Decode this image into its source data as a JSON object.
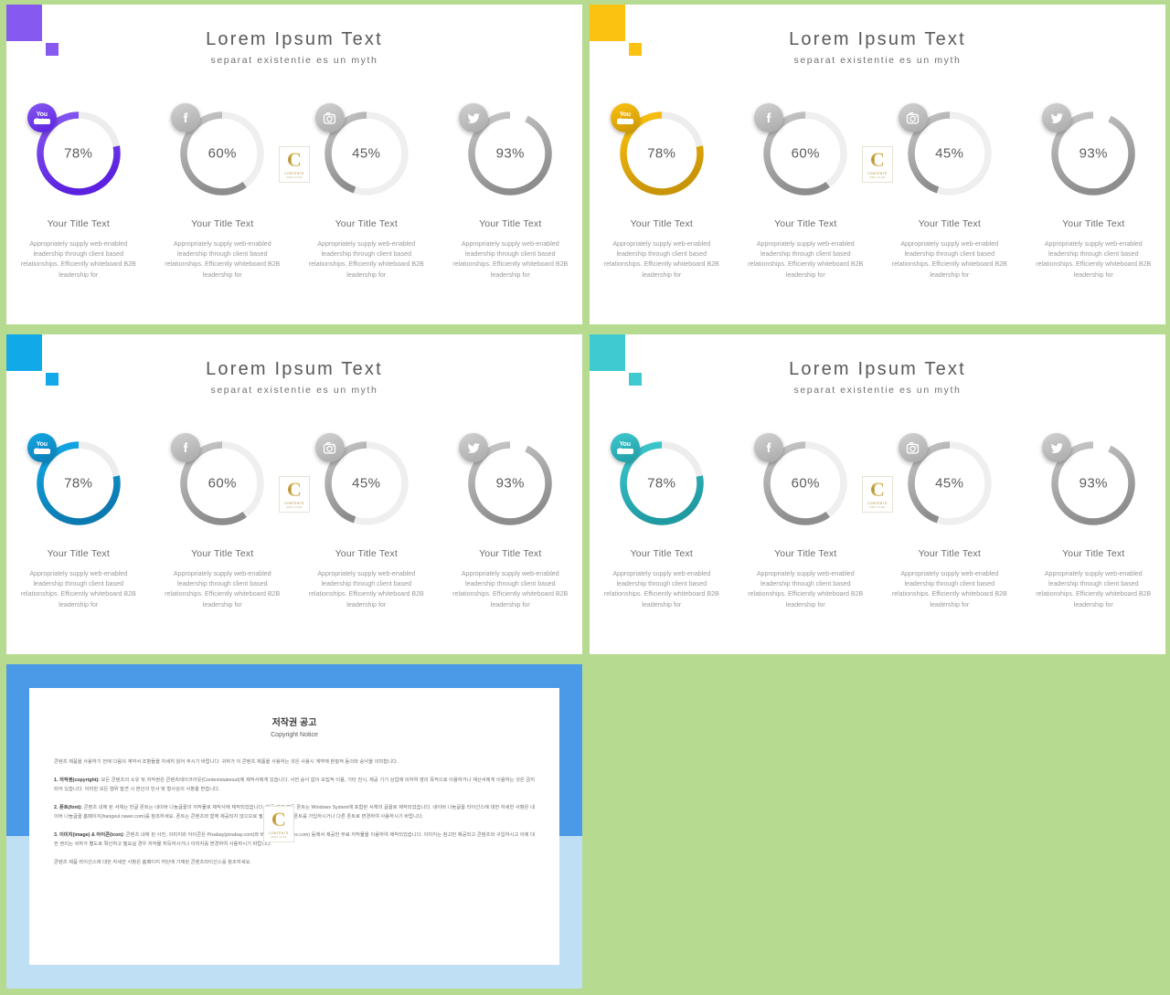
{
  "background_color": "#b6db90",
  "slides": [
    {
      "key": "purple",
      "accent": "#8659f0",
      "accent_dark": "#5b20e0",
      "title": "Lorem Ipsum Text",
      "subtitle": "separat existentie es un myth",
      "items": [
        {
          "icon": "youtube-icon",
          "percent": "78%",
          "value": 78,
          "title": "Your Title Text",
          "body": "Appropriately supply web-enabled leadership through client based relationships. Efficiently whiteboard B2B leadership for",
          "colored": true
        },
        {
          "icon": "facebook-icon",
          "percent": "60%",
          "value": 60,
          "title": "Your Title Text",
          "body": "Appropriately supply web-enabled leadership through client based relationships. Efficiently whiteboard B2B leadership for",
          "colored": false
        },
        {
          "icon": "instagram-icon",
          "percent": "45%",
          "value": 45,
          "title": "Your Title Text",
          "body": "Appropriately supply web-enabled leadership through client based relationships. Efficiently whiteboard B2B leadership for",
          "colored": false
        },
        {
          "icon": "twitter-icon",
          "percent": "93%",
          "value": 93,
          "title": "Your Title Text",
          "body": "Appropriately supply web-enabled leadership through client based relationships. Efficiently whiteboard B2B leadership for",
          "colored": false
        }
      ]
    },
    {
      "key": "yellow",
      "accent": "#fcc211",
      "accent_dark": "#c99405",
      "title": "Lorem Ipsum Text",
      "subtitle": "separat existentie es un myth",
      "items": [
        {
          "icon": "youtube-icon",
          "percent": "78%",
          "value": 78,
          "title": "Your Title Text",
          "body": "Appropriately supply web-enabled leadership through client based relationships. Efficiently whiteboard B2B leadership for",
          "colored": true
        },
        {
          "icon": "facebook-icon",
          "percent": "60%",
          "value": 60,
          "title": "Your Title Text",
          "body": "Appropriately supply web-enabled leadership through client based relationships. Efficiently whiteboard B2B leadership for",
          "colored": false
        },
        {
          "icon": "instagram-icon",
          "percent": "45%",
          "value": 45,
          "title": "Your Title Text",
          "body": "Appropriately supply web-enabled leadership through client based relationships. Efficiently whiteboard B2B leadership for",
          "colored": false
        },
        {
          "icon": "twitter-icon",
          "percent": "93%",
          "value": 93,
          "title": "Your Title Text",
          "body": "Appropriately supply web-enabled leadership through client based relationships. Efficiently whiteboard B2B leadership for",
          "colored": false
        }
      ]
    },
    {
      "key": "blue",
      "accent": "#12a9e8",
      "accent_dark": "#0b7ab0",
      "title": "Lorem Ipsum Text",
      "subtitle": "separat existentie es un myth",
      "items": [
        {
          "icon": "youtube-icon",
          "percent": "78%",
          "value": 78,
          "title": "Your Title Text",
          "body": "Appropriately supply web-enabled leadership through client based relationships. Efficiently whiteboard B2B leadership for",
          "colored": true
        },
        {
          "icon": "facebook-icon",
          "percent": "60%",
          "value": 60,
          "title": "Your Title Text",
          "body": "Appropriately supply web-enabled leadership through client based relationships. Efficiently whiteboard B2B leadership for",
          "colored": false
        },
        {
          "icon": "instagram-icon",
          "percent": "45%",
          "value": 45,
          "title": "Your Title Text",
          "body": "Appropriately supply web-enabled leadership through client based relationships. Efficiently whiteboard B2B leadership for",
          "colored": false
        },
        {
          "icon": "twitter-icon",
          "percent": "93%",
          "value": 93,
          "title": "Your Title Text",
          "body": "Appropriately supply web-enabled leadership through client based relationships. Efficiently whiteboard B2B leadership for",
          "colored": false
        }
      ]
    },
    {
      "key": "teal",
      "accent": "#3ecad0",
      "accent_dark": "#1f9aa2",
      "title": "Lorem Ipsum Text",
      "subtitle": "separat existentie es un myth",
      "items": [
        {
          "icon": "youtube-icon",
          "percent": "78%",
          "value": 78,
          "title": "Your Title Text",
          "body": "Appropriately supply web-enabled leadership through client based relationships. Efficiently whiteboard B2B leadership for",
          "colored": true
        },
        {
          "icon": "facebook-icon",
          "percent": "60%",
          "value": 60,
          "title": "Your Title Text",
          "body": "Appropriately supply web-enabled leadership through client based relationships. Efficiently whiteboard B2B leadership for",
          "colored": false
        },
        {
          "icon": "instagram-icon",
          "percent": "45%",
          "value": 45,
          "title": "Your Title Text",
          "body": "Appropriately supply web-enabled leadership through client based relationships. Efficiently whiteboard B2B leadership for",
          "colored": false
        },
        {
          "icon": "twitter-icon",
          "percent": "93%",
          "value": 93,
          "title": "Your Title Text",
          "body": "Appropriately supply web-enabled leadership through client based relationships. Efficiently whiteboard B2B leadership for",
          "colored": false
        }
      ]
    }
  ],
  "watermark": {
    "letter": "C",
    "line1": "CONTENTS",
    "line2": "REAL CLUB"
  },
  "notice": {
    "band_color": "#4a9ae8",
    "heading_ko": "저작권 공고",
    "heading_en": "Copyright Notice",
    "paragraphs": [
      {
        "label": "",
        "text": "콘텐츠 제품을 사용하기 전에 다음의 계약서 조항들을 자세히 읽어 주시기 바랍니다. 귀하가 이 콘텐츠 제품을 사용하는 것은 사용시 계약에 본질적 동의와 승낙을 의미합니다."
      },
      {
        "label": "1. 저작권(copyright):",
        "text": " 모든 콘텐츠의 소유 및 저작권은 콘텐츠테이크아웃(Contentstakeout)에 제작사에게 있습니다. 사전 승낙 없이 모집적 이용, 기타 전시, 제공 기기 상업에 의하여 영리 목적으로 이용하거나 재산서에게 이용하는 것은 금지되어 있습니다. 이러한 모든 행위 발견 시 본인의 민사 및 형사상의 사항을 받습니다."
      },
      {
        "label": "2. 폰트(font):",
        "text": " 콘텐츠 내에 된 서체는 한글 폰트는 네이버 나눔글꼴의 저작물로 제작사에 제작되었습니다. 한글 외의 모든 폰트는 Windows System에 포함된 서체의 글꼴로 제작되었습니다. 네이버 나눔글꼴 라이선스에 대한 자세한 사항은 네이버 나눔글꼴 홈페이지(hangeul.naver.com)를 참조하세요. 폰트는 콘텐츠와 함께 제공되지 않으므로 필요실 경우 해당 폰트를 가입하시거나 다른 폰트로 변경하여 사용하시기 바랍니다."
      },
      {
        "label": "3. 이미지(image) & 아이콘(icon):",
        "text": " 콘텐츠 내에 된 사진, 이미지와 아이콘은 Pixabay(pixabay.com)와 Webalys(webalys.com) 등에서 제공한 무료 저작물을 이용하여 제작되었습니다. 이미지는 참고만 제공되고 콘텐츠와 구입하시고 이에 대한 권리는 귀하가 별도로 확인하고 필요실 경우 저작물 취득하시거나 이미지를 변경하여 사용하시기 바랍니다."
      }
    ],
    "last_line": "콘텐츠 제품 라이선스에 대한 자세한 사항은 홈페이지 하단에 기재된 콘텐츠라이선스를 참조하세요."
  }
}
